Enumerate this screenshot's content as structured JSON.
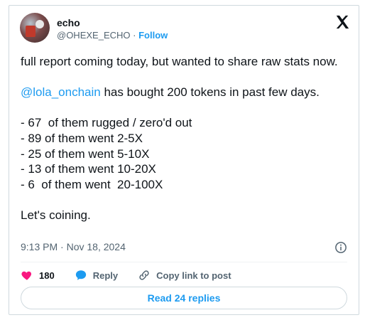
{
  "author": {
    "name": "echo",
    "handle": "@OHEXE_ECHO",
    "separator": "·",
    "follow_label": "Follow"
  },
  "tweet": {
    "line1": "full report coming today, but wanted to share raw stats now.",
    "mention": "@lola_onchain",
    "line2_rest": " has bought 200 tokens in past few days.",
    "stats": [
      "- 67  of them rugged / zero'd out",
      "- 89 of them went 2-5X",
      "- 25 of them went 5-10X",
      "- 13 of them went 10-20X",
      "- 6  of them went  20-100X"
    ],
    "closing": "Let's coining."
  },
  "meta": {
    "timestamp": "9:13 PM · Nov 18, 2024"
  },
  "actions": {
    "like_count": "180",
    "reply_label": "Reply",
    "copy_label": "Copy link to post"
  },
  "read_replies_label": "Read 24 replies",
  "colors": {
    "accent": "#1d9bf0",
    "like": "#f91880",
    "text": "#0f1419",
    "muted": "#536471",
    "border": "#cfd9de"
  },
  "icons": [
    "x-logo-icon",
    "info-icon",
    "heart-icon",
    "reply-bubble-icon",
    "link-icon"
  ]
}
